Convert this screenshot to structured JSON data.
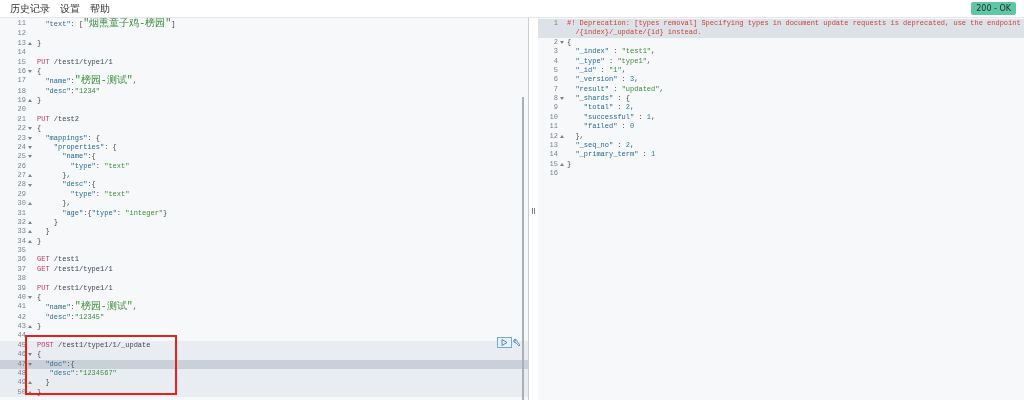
{
  "menu": [
    {
      "label": "历史记录"
    },
    {
      "label": "设置"
    },
    {
      "label": "帮助"
    }
  ],
  "status_badge": "200 - OK",
  "request_editor": {
    "lines": [
      {
        "no": "11",
        "kind": "plain",
        "selected": false,
        "cursor": false,
        "tokens": [
          {
            "kind": "key",
            "text": "  \"text\""
          },
          {
            "kind": "punct",
            "text": ": ["
          },
          {
            "kind": "str",
            "text": "\"烟熏童子鸡-榜园\""
          },
          {
            "kind": "punct",
            "text": "]"
          }
        ]
      },
      {
        "no": "12",
        "kind": "plain",
        "selected": false,
        "cursor": false
      },
      {
        "no": "13",
        "kind": "closer",
        "selected": false,
        "cursor": false,
        "tokens": [
          {
            "kind": "punct",
            "text": "}"
          }
        ]
      },
      {
        "no": "14",
        "kind": "plain",
        "selected": false,
        "cursor": false
      },
      {
        "no": "15",
        "kind": "plain",
        "selected": false,
        "cursor": false,
        "tokens": [
          {
            "kind": "method",
            "text": "PUT"
          },
          {
            "kind": "path",
            "text": " /test1/type1/1"
          }
        ]
      },
      {
        "no": "16",
        "kind": "opener",
        "selected": false,
        "cursor": false,
        "tokens": [
          {
            "kind": "punct",
            "text": "{"
          }
        ]
      },
      {
        "no": "17",
        "kind": "plain",
        "selected": false,
        "cursor": false,
        "tokens": [
          {
            "kind": "key",
            "text": "  \"name\""
          },
          {
            "kind": "punct",
            "text": ":"
          },
          {
            "kind": "str",
            "text": "\"榜园-测试\""
          },
          {
            "kind": "punct",
            "text": ","
          }
        ]
      },
      {
        "no": "18",
        "kind": "plain",
        "selected": false,
        "cursor": false,
        "tokens": [
          {
            "kind": "key",
            "text": "  \"desc\""
          },
          {
            "kind": "punct",
            "text": ":"
          },
          {
            "kind": "str",
            "text": "\"1234\""
          }
        ]
      },
      {
        "no": "19",
        "kind": "closer",
        "selected": false,
        "cursor": false,
        "tokens": [
          {
            "kind": "punct",
            "text": "}"
          }
        ]
      },
      {
        "no": "20",
        "kind": "plain",
        "selected": false,
        "cursor": false
      },
      {
        "no": "21",
        "kind": "plain",
        "selected": false,
        "cursor": false,
        "tokens": [
          {
            "kind": "method",
            "text": "PUT"
          },
          {
            "kind": "path",
            "text": " /test2"
          }
        ]
      },
      {
        "no": "22",
        "kind": "opener",
        "selected": false,
        "cursor": false,
        "tokens": [
          {
            "kind": "punct",
            "text": "{"
          }
        ]
      },
      {
        "no": "23",
        "kind": "opener",
        "selected": false,
        "cursor": false,
        "tokens": [
          {
            "kind": "key",
            "text": "  \"mappings\""
          },
          {
            "kind": "punct",
            "text": ": {"
          }
        ]
      },
      {
        "no": "24",
        "kind": "opener",
        "selected": false,
        "cursor": false,
        "tokens": [
          {
            "kind": "key",
            "text": "    \"properties\""
          },
          {
            "kind": "punct",
            "text": ": {"
          }
        ]
      },
      {
        "no": "25",
        "kind": "opener",
        "selected": false,
        "cursor": false,
        "tokens": [
          {
            "kind": "key",
            "text": "      \"name\""
          },
          {
            "kind": "punct",
            "text": ":{"
          }
        ]
      },
      {
        "no": "26",
        "kind": "plain",
        "selected": false,
        "cursor": false,
        "tokens": [
          {
            "kind": "key",
            "text": "        \"type\""
          },
          {
            "kind": "punct",
            "text": ": "
          },
          {
            "kind": "str",
            "text": "\"text\""
          }
        ]
      },
      {
        "no": "27",
        "kind": "closer",
        "selected": false,
        "cursor": false,
        "tokens": [
          {
            "kind": "punct",
            "text": "      },"
          }
        ]
      },
      {
        "no": "28",
        "kind": "opener",
        "selected": false,
        "cursor": false,
        "tokens": [
          {
            "kind": "key",
            "text": "      \"desc\""
          },
          {
            "kind": "punct",
            "text": ":{"
          }
        ]
      },
      {
        "no": "29",
        "kind": "plain",
        "selected": false,
        "cursor": false,
        "tokens": [
          {
            "kind": "key",
            "text": "        \"type\""
          },
          {
            "kind": "punct",
            "text": ": "
          },
          {
            "kind": "str",
            "text": "\"text\""
          }
        ]
      },
      {
        "no": "30",
        "kind": "closer",
        "selected": false,
        "cursor": false,
        "tokens": [
          {
            "kind": "punct",
            "text": "      },"
          }
        ]
      },
      {
        "no": "31",
        "kind": "plain",
        "selected": false,
        "cursor": false,
        "tokens": [
          {
            "kind": "key",
            "text": "      \"age\""
          },
          {
            "kind": "punct",
            "text": ":{"
          },
          {
            "kind": "key",
            "text": "\"type\""
          },
          {
            "kind": "punct",
            "text": ": "
          },
          {
            "kind": "str",
            "text": "\"integer\""
          },
          {
            "kind": "punct",
            "text": "}"
          }
        ]
      },
      {
        "no": "32",
        "kind": "closer",
        "selected": false,
        "cursor": false,
        "tokens": [
          {
            "kind": "punct",
            "text": "    }"
          }
        ]
      },
      {
        "no": "33",
        "kind": "closer",
        "selected": false,
        "cursor": false,
        "tokens": [
          {
            "kind": "punct",
            "text": "  }"
          }
        ]
      },
      {
        "no": "34",
        "kind": "closer",
        "selected": false,
        "cursor": false,
        "tokens": [
          {
            "kind": "punct",
            "text": "}"
          }
        ]
      },
      {
        "no": "35",
        "kind": "plain",
        "selected": false,
        "cursor": false
      },
      {
        "no": "36",
        "kind": "plain",
        "selected": false,
        "cursor": false,
        "tokens": [
          {
            "kind": "method",
            "text": "GET"
          },
          {
            "kind": "path",
            "text": " /test1"
          }
        ]
      },
      {
        "no": "37",
        "kind": "plain",
        "selected": false,
        "cursor": false,
        "tokens": [
          {
            "kind": "method",
            "text": "GET"
          },
          {
            "kind": "path",
            "text": " /test1/type1/1"
          }
        ]
      },
      {
        "no": "38",
        "kind": "plain",
        "selected": false,
        "cursor": false
      },
      {
        "no": "39",
        "kind": "plain",
        "selected": false,
        "cursor": false,
        "tokens": [
          {
            "kind": "method",
            "text": "PUT"
          },
          {
            "kind": "path",
            "text": " /test1/type1/1"
          }
        ]
      },
      {
        "no": "40",
        "kind": "opener",
        "selected": false,
        "cursor": false,
        "tokens": [
          {
            "kind": "punct",
            "text": "{"
          }
        ]
      },
      {
        "no": "41",
        "kind": "plain",
        "selected": false,
        "cursor": false,
        "tokens": [
          {
            "kind": "key",
            "text": "  \"name\""
          },
          {
            "kind": "punct",
            "text": ":"
          },
          {
            "kind": "str",
            "text": "\"榜园-测试\""
          },
          {
            "kind": "punct",
            "text": ","
          }
        ]
      },
      {
        "no": "42",
        "kind": "plain",
        "selected": false,
        "cursor": false,
        "tokens": [
          {
            "kind": "key",
            "text": "  \"desc\""
          },
          {
            "kind": "punct",
            "text": ":"
          },
          {
            "kind": "str",
            "text": "\"12345\""
          }
        ]
      },
      {
        "no": "43",
        "kind": "closer",
        "selected": false,
        "cursor": false,
        "tokens": [
          {
            "kind": "punct",
            "text": "}"
          }
        ]
      },
      {
        "no": "44",
        "kind": "plain",
        "selected": false,
        "cursor": false
      },
      {
        "no": "45",
        "kind": "plain",
        "selected": true,
        "cursor": false,
        "tokens": [
          {
            "kind": "method",
            "text": "POST"
          },
          {
            "kind": "path",
            "text": " /test1/type1/1/_update"
          }
        ]
      },
      {
        "no": "46",
        "kind": "opener",
        "selected": true,
        "cursor": false,
        "tokens": [
          {
            "kind": "punct",
            "text": "{"
          }
        ]
      },
      {
        "no": "47",
        "kind": "opener",
        "selected": true,
        "cursor": true,
        "tokens": [
          {
            "kind": "key",
            "text": "  \"doc\""
          },
          {
            "kind": "punct",
            "text": ":{"
          }
        ]
      },
      {
        "no": "48",
        "kind": "plain",
        "selected": true,
        "cursor": false,
        "tokens": [
          {
            "kind": "key",
            "text": "   \"desc\""
          },
          {
            "kind": "punct",
            "text": ":"
          },
          {
            "kind": "str",
            "text": "\"1234567\""
          }
        ]
      },
      {
        "no": "49",
        "kind": "closer",
        "selected": true,
        "cursor": false,
        "tokens": [
          {
            "kind": "punct",
            "text": "  }"
          }
        ]
      },
      {
        "no": "50",
        "kind": "closer",
        "selected": true,
        "cursor": false,
        "tokens": [
          {
            "kind": "punct",
            "text": "}"
          }
        ]
      }
    ]
  },
  "response_editor": {
    "lines": [
      {
        "no": "1",
        "kind": "plain",
        "cursor": true,
        "tokens": [
          {
            "kind": "warn",
            "text": "#! Deprecation: [types removal] Specifying types in document update requests is deprecated, use the endpoint /{index}/_update/{id} instead."
          }
        ]
      },
      {
        "no": "2",
        "kind": "opener",
        "cursor": false,
        "tokens": [
          {
            "kind": "punct",
            "text": "{"
          }
        ]
      },
      {
        "no": "3",
        "kind": "plain",
        "cursor": false,
        "tokens": [
          {
            "kind": "key",
            "text": "  \"_index\""
          },
          {
            "kind": "punct",
            "text": " : "
          },
          {
            "kind": "str",
            "text": "\"test1\""
          },
          {
            "kind": "punct",
            "text": ","
          }
        ]
      },
      {
        "no": "4",
        "kind": "plain",
        "cursor": false,
        "tokens": [
          {
            "kind": "key",
            "text": "  \"_type\""
          },
          {
            "kind": "punct",
            "text": " : "
          },
          {
            "kind": "str",
            "text": "\"type1\""
          },
          {
            "kind": "punct",
            "text": ","
          }
        ]
      },
      {
        "no": "5",
        "kind": "plain",
        "cursor": false,
        "tokens": [
          {
            "kind": "key",
            "text": "  \"_id\""
          },
          {
            "kind": "punct",
            "text": " : "
          },
          {
            "kind": "str",
            "text": "\"1\""
          },
          {
            "kind": "punct",
            "text": ","
          }
        ]
      },
      {
        "no": "6",
        "kind": "plain",
        "cursor": false,
        "tokens": [
          {
            "kind": "key",
            "text": "  \"_version\""
          },
          {
            "kind": "punct",
            "text": " : "
          },
          {
            "kind": "num",
            "text": "3"
          },
          {
            "kind": "punct",
            "text": ","
          }
        ]
      },
      {
        "no": "7",
        "kind": "plain",
        "cursor": false,
        "tokens": [
          {
            "kind": "key",
            "text": "  \"result\""
          },
          {
            "kind": "punct",
            "text": " : "
          },
          {
            "kind": "str",
            "text": "\"updated\""
          },
          {
            "kind": "punct",
            "text": ","
          }
        ]
      },
      {
        "no": "8",
        "kind": "opener",
        "cursor": false,
        "tokens": [
          {
            "kind": "key",
            "text": "  \"_shards\""
          },
          {
            "kind": "punct",
            "text": " : {"
          }
        ]
      },
      {
        "no": "9",
        "kind": "plain",
        "cursor": false,
        "tokens": [
          {
            "kind": "key",
            "text": "    \"total\""
          },
          {
            "kind": "punct",
            "text": " : "
          },
          {
            "kind": "num",
            "text": "2"
          },
          {
            "kind": "punct",
            "text": ","
          }
        ]
      },
      {
        "no": "10",
        "kind": "plain",
        "cursor": false,
        "tokens": [
          {
            "kind": "key",
            "text": "    \"successful\""
          },
          {
            "kind": "punct",
            "text": " : "
          },
          {
            "kind": "num",
            "text": "1"
          },
          {
            "kind": "punct",
            "text": ","
          }
        ]
      },
      {
        "no": "11",
        "kind": "plain",
        "cursor": false,
        "tokens": [
          {
            "kind": "key",
            "text": "    \"failed\""
          },
          {
            "kind": "punct",
            "text": " : "
          },
          {
            "kind": "num",
            "text": "0"
          }
        ]
      },
      {
        "no": "12",
        "kind": "closer",
        "cursor": false,
        "tokens": [
          {
            "kind": "punct",
            "text": "  },"
          }
        ]
      },
      {
        "no": "13",
        "kind": "plain",
        "cursor": false,
        "tokens": [
          {
            "kind": "key",
            "text": "  \"_seq_no\""
          },
          {
            "kind": "punct",
            "text": " : "
          },
          {
            "kind": "num",
            "text": "2"
          },
          {
            "kind": "punct",
            "text": ","
          }
        ]
      },
      {
        "no": "14",
        "kind": "plain",
        "cursor": false,
        "tokens": [
          {
            "kind": "key",
            "text": "  \"_primary_term\""
          },
          {
            "kind": "punct",
            "text": " : "
          },
          {
            "kind": "num",
            "text": "1"
          }
        ]
      },
      {
        "no": "15",
        "kind": "closer",
        "cursor": false,
        "tokens": [
          {
            "kind": "punct",
            "text": "}"
          }
        ]
      },
      {
        "no": "16",
        "kind": "plain",
        "cursor": false
      }
    ]
  }
}
